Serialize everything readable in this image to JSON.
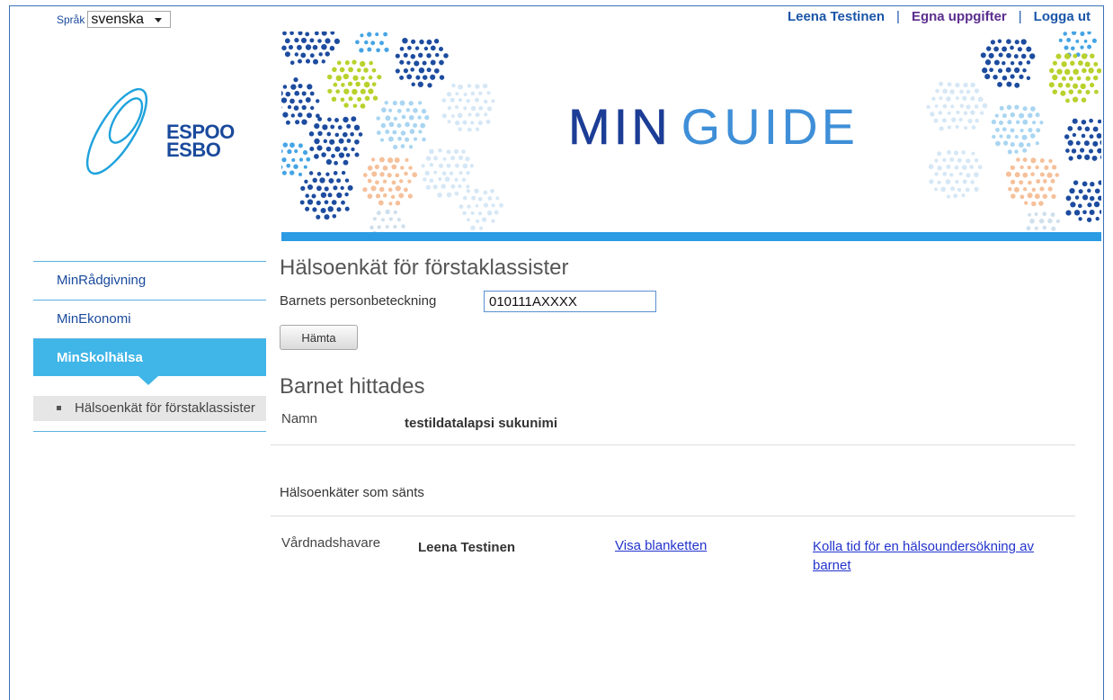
{
  "colors": {
    "brand_blue": "#1a4a9c",
    "accent_cyan": "#40b5e8",
    "banner_bar": "#2b9be4",
    "link": "#2233cc",
    "visited_link": "#5b2d8e",
    "logo_cyan": "#1fa2dc"
  },
  "icons": {
    "language_dropdown": "dropdown-arrow-icon",
    "logo": "espoo-swirl-icon",
    "active_nav_marker": "active-indicator-arrow",
    "submenu_bullet": "square-bullet-icon"
  },
  "language": {
    "label": "Språk",
    "selected": "svenska"
  },
  "user_menu": {
    "user_name": "Leena Testinen",
    "separator": "|",
    "profile_link": "Egna uppgifter",
    "logout_link": "Logga ut"
  },
  "logo": {
    "line1": "ESPOO",
    "line2": "ESBO"
  },
  "banner": {
    "title_part1": "MIN",
    "title_part2": "GUIDE"
  },
  "nav": {
    "items": [
      {
        "label": "MinRådgivning",
        "active": false
      },
      {
        "label": "MinEkonomi",
        "active": false
      },
      {
        "label": "MinSkolhälsa",
        "active": true
      }
    ],
    "subitems": [
      {
        "label": "Hälsoenkät för förstaklassister"
      }
    ]
  },
  "form": {
    "title": "Hälsoenkät för förstaklassister",
    "id_label": "Barnets personbeteckning",
    "id_value": "010111AXXXX",
    "fetch_button": "Hämta"
  },
  "result": {
    "heading": "Barnet hittades",
    "name_label": "Namn",
    "name_value": "testildatalapsi sukunimi",
    "sent_heading": "Hälsoenkäter som sänts",
    "rows": [
      {
        "role": "Vårdnadshavare",
        "person": "Leena Testinen",
        "view_link": "Visa blanketten",
        "book_link": "Kolla tid för en hälsoundersökning av barnet"
      }
    ]
  }
}
